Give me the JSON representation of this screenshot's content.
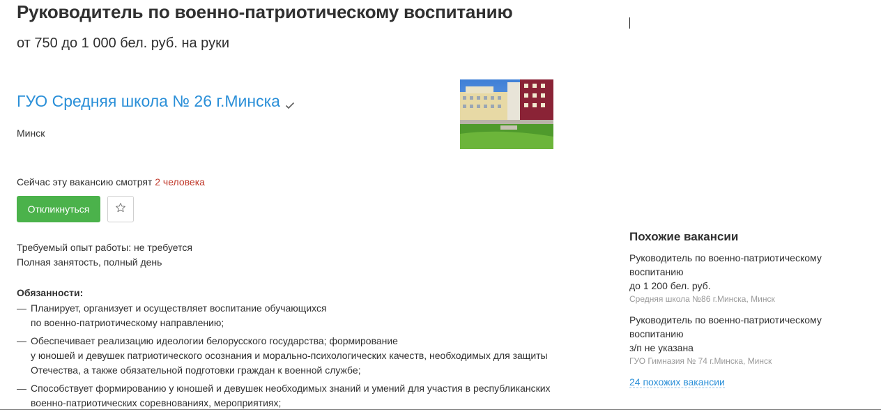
{
  "vacancy": {
    "title": "Руководитель по военно-патриотическому воспитанию",
    "salary": "от 750 до 1 000 бел. руб. на руки",
    "company": "ГУО Средняя школа № 26 г.Минска",
    "city": "Минск",
    "viewers_text": "Сейчас эту вакансию смотрят ",
    "viewers_count": "2 человека",
    "apply_label": "Откликнуться",
    "experience": "Требуемый опыт работы: не требуется",
    "employment": "Полная занятость, полный день",
    "duties_heading": "Обязанности:",
    "duties": [
      {
        "dash": "—",
        "lines": [
          "Планирует, организует и осуществляет воспитание обучающихся",
          "по военно-патриотическому направлению;"
        ]
      },
      {
        "dash": "—",
        "lines": [
          "Обеспечивает реализацию идеологии белорусского государства; формирование",
          "у юношей и девушек патриотического осознания и морально-психологических качеств, необходимых для защиты",
          "Отечества, а также обязательной подготовки граждан к военной службе;"
        ]
      },
      {
        "dash": "—",
        "lines": [
          "Способствует формированию у юношей и девушек необходимых знаний и умений для участия в республиканских",
          "военно-патриотических соревнованиях, мероприятиях;"
        ]
      }
    ]
  },
  "sidebar": {
    "heading": "Похожие вакансии",
    "items": [
      {
        "title_l1": "Руководитель по военно-патриотическому",
        "title_l2": "воспитанию",
        "salary": "до 1 200 бел. руб.",
        "company": "Средняя школа №86 г.Минска, Минск"
      },
      {
        "title_l1": "Руководитель по военно-патриотическому",
        "title_l2": "воспитанию",
        "salary": "з/п не указана",
        "company": "ГУО Гимназия № 74 г.Минска, Минск"
      }
    ],
    "more_link": "24 похожих вакансии"
  },
  "icons": {
    "verified": "check-icon",
    "favorite": "star-icon"
  },
  "colors": {
    "accent": "#2a8fd8",
    "apply": "#4bb24b",
    "viewers": "#c0392b"
  }
}
